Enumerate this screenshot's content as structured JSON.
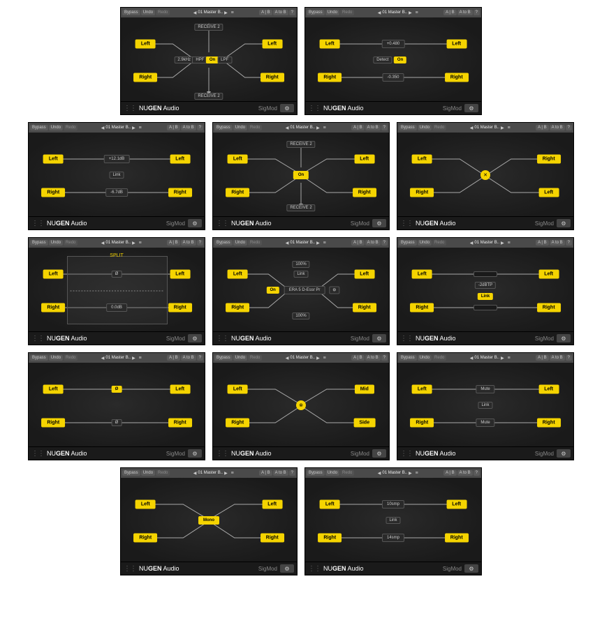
{
  "topbar": {
    "bypass": "Bypass",
    "undo": "Undo",
    "redo": "Redo",
    "preset": "01 Master B..",
    "ab": "A | B",
    "atob": "A to B",
    "help": "?",
    "list_icon": "≡"
  },
  "footer": {
    "brand_thin": "NU",
    "brand_bold": "GEN",
    "brand_tail": " Audio",
    "sigmod": "SigMod",
    "gear": "⚙"
  },
  "labels": {
    "left": "Left",
    "right": "Right",
    "mid": "Mid",
    "side": "Side"
  },
  "panels": [
    {
      "id": "crossover",
      "center": {
        "hpf": "HPF",
        "on": "On",
        "lpf": "LPF",
        "val": "2.9kHz"
      },
      "top": "RECEIVE 2",
      "bottom": "RECEIVE 2"
    },
    {
      "id": "dcoffset",
      "top_val": "+0.480",
      "bot_val": "-0.350",
      "detect": "Detect",
      "on": "On"
    },
    {
      "id": "trim",
      "top_val": "+12.1dB",
      "bot_val": "-6.7dB",
      "link": "Link"
    },
    {
      "id": "insert_send",
      "on": "On",
      "top": "RECEIVE 2",
      "bottom": "RECEIVE 2"
    },
    {
      "id": "switch"
    },
    {
      "id": "split",
      "title": "SPLIT",
      "phase": "Ø",
      "val": "0.0dB"
    },
    {
      "id": "insert_plugin",
      "pct_top": "100%",
      "pct_bot": "100%",
      "link": "Link",
      "on": "On",
      "name": "ERA 5 D-Essr Pr",
      "gear": "⚙"
    },
    {
      "id": "protect",
      "val": "-2dBTP",
      "link": "Link"
    },
    {
      "id": "phase",
      "sym": "Ø"
    },
    {
      "id": "midside",
      "sym": "⊗",
      "out_top": "Mid",
      "out_bot": "Side"
    },
    {
      "id": "mute",
      "label": "Mute",
      "link": "Link"
    },
    {
      "id": "mono",
      "label": "Mono"
    },
    {
      "id": "delay",
      "top_val": "10smp",
      "bot_val": "14smp",
      "link": "Link"
    }
  ]
}
